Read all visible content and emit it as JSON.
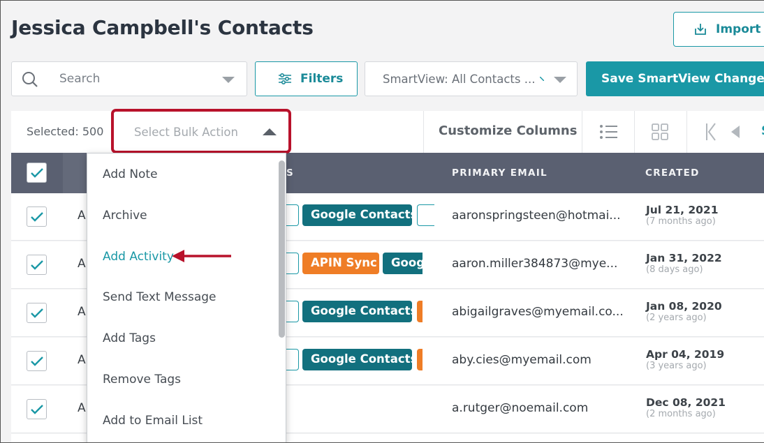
{
  "title": "Jessica Campbell's Contacts",
  "import_label": "Import",
  "search": {
    "placeholder": "Search"
  },
  "filters_label": "Filters",
  "smartview_label": "SmartView: All Contacts ...",
  "save_smartview_label": "Save SmartView Changes",
  "toolbar": {
    "selected_text": "Selected: 500",
    "bulk_action_placeholder": "Select Bulk Action",
    "customize_columns": "Customize Columns"
  },
  "table": {
    "columns": {
      "tags_partial": "S",
      "primary_email": "PRIMARY EMAIL",
      "created": "CREATED"
    },
    "rows": [
      {
        "initial": "A",
        "email": "aaronspringsteen@hotmai...",
        "created": "Jul 21, 2021",
        "ago": "(7 months ago)",
        "tags": [
          "Google Contacts"
        ]
      },
      {
        "initial": "A",
        "email": "aaron.miller384873@mye...",
        "created": "Jan 31, 2022",
        "ago": "(8 days ago)",
        "tags": [
          "APIN Sync",
          "Goog"
        ]
      },
      {
        "initial": "A",
        "email": "abigailgraves@myemail.co...",
        "created": "Jan 08, 2020",
        "ago": "(2 years ago)",
        "tags": [
          "Google Contacts"
        ]
      },
      {
        "initial": "A",
        "email": "aby.cies@myemail.com",
        "created": "Apr 04, 2019",
        "ago": "(3 years ago)",
        "tags": [
          "Google Contacts"
        ]
      },
      {
        "initial": "A",
        "email": "a.rutger@noemail.com",
        "created": "Dec 08, 2021",
        "ago": "(2 months ago)",
        "tags": []
      }
    ]
  },
  "bulk_menu": {
    "items": [
      "Add Note",
      "Archive",
      "Add Activity",
      "Send Text Message",
      "Add Tags",
      "Remove Tags",
      "Add to Email List"
    ],
    "highlighted": "Add Activity"
  },
  "colors": {
    "accent": "#1a98a6",
    "tag_teal": "#12707e",
    "tag_orange": "#ef7d26",
    "highlight_box": "#b8122b",
    "header": "#5a6071"
  }
}
